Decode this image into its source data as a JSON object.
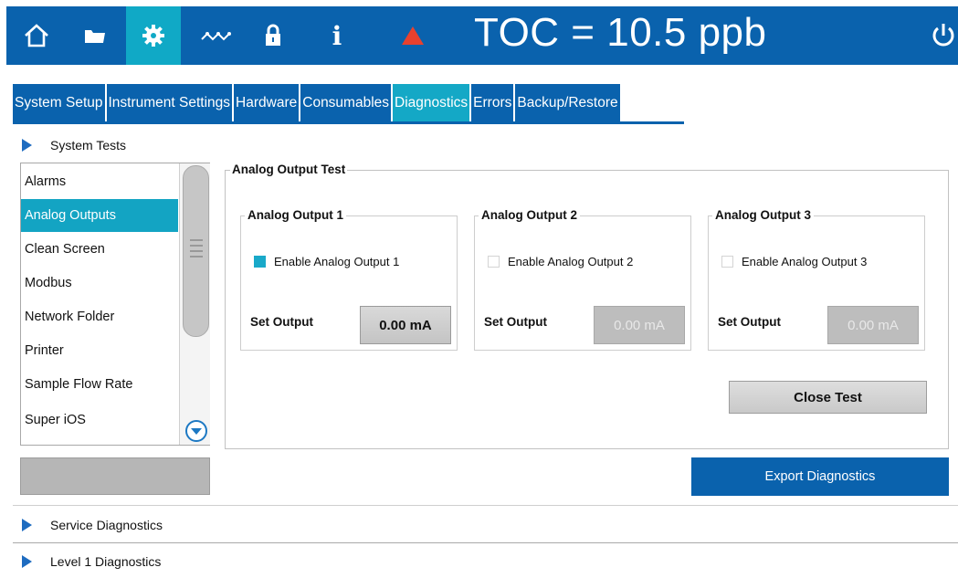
{
  "header": {
    "icons": [
      "home-icon",
      "folder-icon",
      "gear-icon",
      "trend-icon",
      "lock-icon",
      "info-icon",
      "alarm-icon",
      "power-icon"
    ],
    "active_icon": "gear-icon",
    "toc_text": "TOC = 10.5 ppb",
    "colors": {
      "bar": "#0a62ad",
      "active": "#10a9c6",
      "alarm": "#e8412e"
    }
  },
  "tabs": [
    {
      "label": "System Setup"
    },
    {
      "label": "Instrument Settings"
    },
    {
      "label": "Hardware"
    },
    {
      "label": "Consumables"
    },
    {
      "label": "Diagnostics"
    },
    {
      "label": "Errors"
    },
    {
      "label": "Backup/Restore"
    }
  ],
  "active_tab": "Diagnostics",
  "sections": {
    "system_tests": "System Tests",
    "service_diagnostics": "Service Diagnostics",
    "level1_diagnostics": "Level 1 Diagnostics"
  },
  "test_list": {
    "items": [
      "Alarms",
      "Analog Outputs",
      "Clean Screen",
      "Modbus",
      "Network Folder",
      "Printer",
      "Sample Flow Rate",
      "Super iOS"
    ],
    "selected": "Analog Outputs"
  },
  "analog_test": {
    "title": "Analog Output Test",
    "outputs": [
      {
        "title": "Analog Output 1",
        "enable_label": "Enable Analog Output  1",
        "enabled": true,
        "set_label": "Set Output",
        "value": "0.00 mA"
      },
      {
        "title": "Analog Output 2",
        "enable_label": "Enable Analog Output  2",
        "enabled": false,
        "set_label": "Set Output",
        "value": "0.00 mA"
      },
      {
        "title": "Analog Output 3",
        "enable_label": "Enable Analog Output  3",
        "enabled": false,
        "set_label": "Set Output",
        "value": "0.00 mA"
      }
    ],
    "close_label": "Close Test"
  },
  "buttons": {
    "export": "Export Diagnostics"
  }
}
